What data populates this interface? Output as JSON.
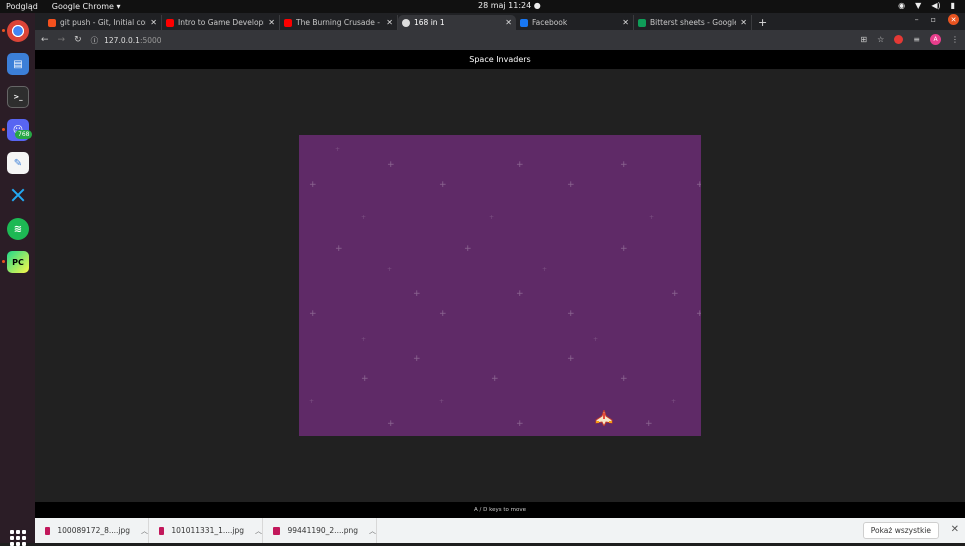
{
  "system_bar": {
    "activities": "Podgląd",
    "app_menu": "Google Chrome ▾",
    "clock": "28 maj  11:24 ●"
  },
  "dock": {
    "discord_badge": "768"
  },
  "tabs": [
    {
      "label": "git push - Git, Initial comm",
      "icon_color": "#f4511e"
    },
    {
      "label": "Intro to Game Developme",
      "icon_color": "#ff0000"
    },
    {
      "label": "The Burning Crusade - Po",
      "icon_color": "#ff0000"
    },
    {
      "label": "168 in 1",
      "icon_color": "#dddddd"
    },
    {
      "label": "Facebook",
      "icon_color": "#1877f2"
    },
    {
      "label": "Bitterst sheets - Google S",
      "icon_color": "#0f9d58"
    }
  ],
  "address_bar": {
    "host": "127.0.0.1",
    "port": ":5000"
  },
  "profile_initial": "A",
  "page": {
    "title": "Space Invaders",
    "footer_hint": "A / D keys to move"
  },
  "downloads": [
    {
      "name": "100089172_8....jpg"
    },
    {
      "name": "101011331_1....jpg"
    },
    {
      "name": "99441190_2....png"
    }
  ],
  "downloads_show_all": "Pokaż wszystkie"
}
